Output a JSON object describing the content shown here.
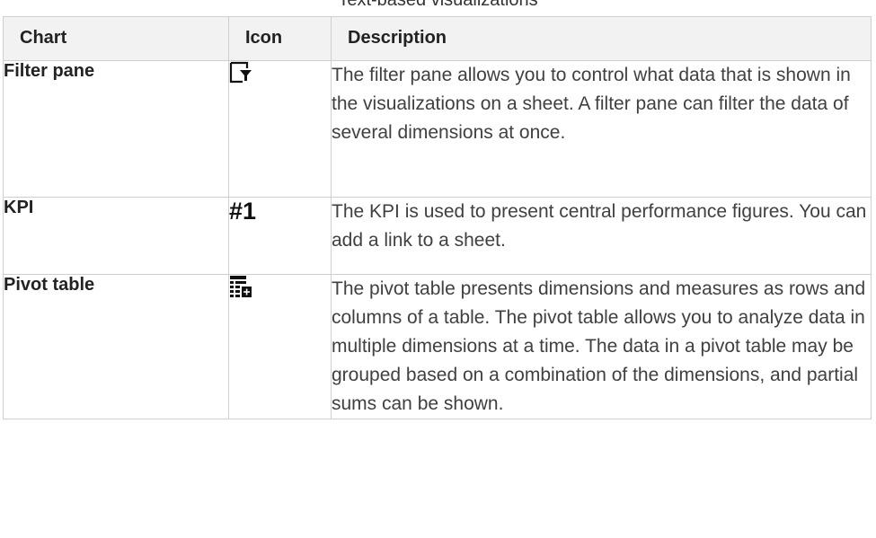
{
  "caption": "Text-based visualizations",
  "table": {
    "headers": [
      "Chart",
      "Icon",
      "Description"
    ],
    "rows": [
      {
        "chart": "Filter pane",
        "icon": "filter-pane-icon",
        "description": "The filter pane allows you to control what data that is shown in the visualizations on a sheet. A filter pane can filter the data of several dimensions at once."
      },
      {
        "chart": "KPI",
        "icon": "kpi-icon",
        "icon_text": "#1",
        "description": "The KPI is used to present central performance figures. You can add a link to a sheet."
      },
      {
        "chart": "Pivot table",
        "icon": "pivot-table-icon",
        "description": "The pivot table presents dimensions and measures as rows and columns of a table. The pivot table allows you to analyze data in multiple dimensions at a time. The data in a pivot table may be grouped based on a combination of the dimensions, and partial sums can be shown."
      }
    ]
  }
}
